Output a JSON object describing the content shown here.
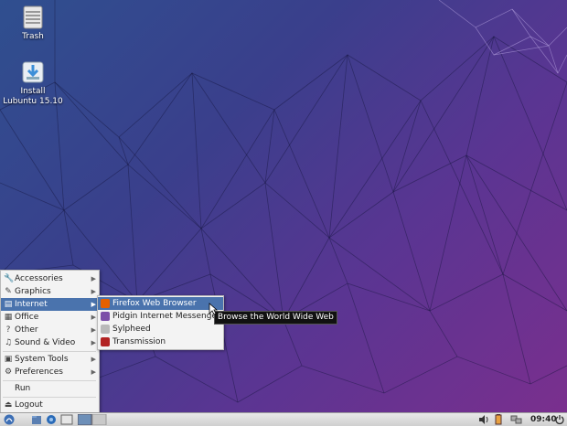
{
  "desktop": {
    "icons": [
      {
        "label": "Trash",
        "icon": "trash-icon"
      },
      {
        "label": "Install\nLubuntu 15.10",
        "icon": "install-icon",
        "label_line1": "Install",
        "label_line2": "Lubuntu 15.10"
      }
    ]
  },
  "main_menu": {
    "items": [
      {
        "label": "Accessories",
        "icon": "accessories-icon",
        "has_submenu": true
      },
      {
        "label": "Graphics",
        "icon": "graphics-icon",
        "has_submenu": true
      },
      {
        "label": "Internet",
        "icon": "internet-icon",
        "has_submenu": true,
        "active": true
      },
      {
        "label": "Office",
        "icon": "office-icon",
        "has_submenu": true
      },
      {
        "label": "Other",
        "icon": "other-icon",
        "has_submenu": true
      },
      {
        "label": "Sound & Video",
        "icon": "sound-video-icon",
        "has_submenu": true
      },
      {
        "label": "System Tools",
        "icon": "system-tools-icon",
        "has_submenu": true
      },
      {
        "label": "Preferences",
        "icon": "preferences-icon",
        "has_submenu": true
      },
      {
        "label": "Run",
        "icon": "run-icon",
        "has_submenu": false
      },
      {
        "label": "Logout",
        "icon": "logout-icon",
        "has_submenu": false
      }
    ]
  },
  "internet_submenu": {
    "items": [
      {
        "label": "Firefox Web Browser",
        "icon": "firefox-icon",
        "active": true
      },
      {
        "label": "Pidgin Internet Messenger",
        "icon": "pidgin-icon"
      },
      {
        "label": "Sylpheed",
        "icon": "sylpheed-icon"
      },
      {
        "label": "Transmission",
        "icon": "transmission-icon"
      }
    ]
  },
  "tooltip": {
    "text": "Browse the World Wide Web"
  },
  "taskbar": {
    "clock": "09:40"
  },
  "colors": {
    "highlight": "#4a73ad",
    "menu_bg": "#f3f3f3",
    "desktop_left": "#2f4f8f",
    "desktop_right": "#7a2f8e"
  }
}
